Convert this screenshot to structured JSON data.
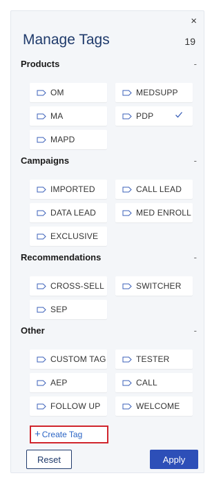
{
  "panel": {
    "title": "Manage Tags",
    "count": "19",
    "close_label": "×"
  },
  "sections": [
    {
      "name": "Products",
      "collapse_label": "-",
      "tags": [
        {
          "label": "OM",
          "checked": false
        },
        {
          "label": "MEDSUPP",
          "checked": false
        },
        {
          "label": "MA",
          "checked": false
        },
        {
          "label": "PDP",
          "checked": true
        },
        {
          "label": "MAPD",
          "checked": false
        }
      ]
    },
    {
      "name": "Campaigns",
      "collapse_label": "-",
      "tags": [
        {
          "label": "IMPORTED",
          "checked": false
        },
        {
          "label": "CALL LEAD",
          "checked": false
        },
        {
          "label": "DATA LEAD",
          "checked": false
        },
        {
          "label": "MED ENROLL",
          "checked": false
        },
        {
          "label": "EXCLUSIVE",
          "checked": false
        }
      ]
    },
    {
      "name": "Recommendations",
      "collapse_label": "-",
      "tags": [
        {
          "label": "CROSS-SELL",
          "checked": false
        },
        {
          "label": "SWITCHER",
          "checked": false
        },
        {
          "label": "SEP",
          "checked": false
        }
      ]
    },
    {
      "name": "Other",
      "collapse_label": "-",
      "tags": [
        {
          "label": "CUSTOM TAG",
          "checked": false
        },
        {
          "label": "TESTER",
          "checked": false
        },
        {
          "label": "AEP",
          "checked": false
        },
        {
          "label": "CALL",
          "checked": false
        },
        {
          "label": "FOLLOW UP",
          "checked": false
        },
        {
          "label": "WELCOME",
          "checked": false
        }
      ]
    }
  ],
  "create_tag": {
    "plus": "+",
    "label": "Create Tag"
  },
  "buttons": {
    "reset": "Reset",
    "apply": "Apply"
  },
  "colors": {
    "title": "#1f3a6b",
    "accent": "#2d4fb8",
    "link": "#2a64c5",
    "highlight_border": "#d0242c",
    "panel_bg": "#f4f6f9"
  },
  "icons": {
    "tag": "tag-icon",
    "check": "check-icon",
    "close": "close-icon"
  }
}
